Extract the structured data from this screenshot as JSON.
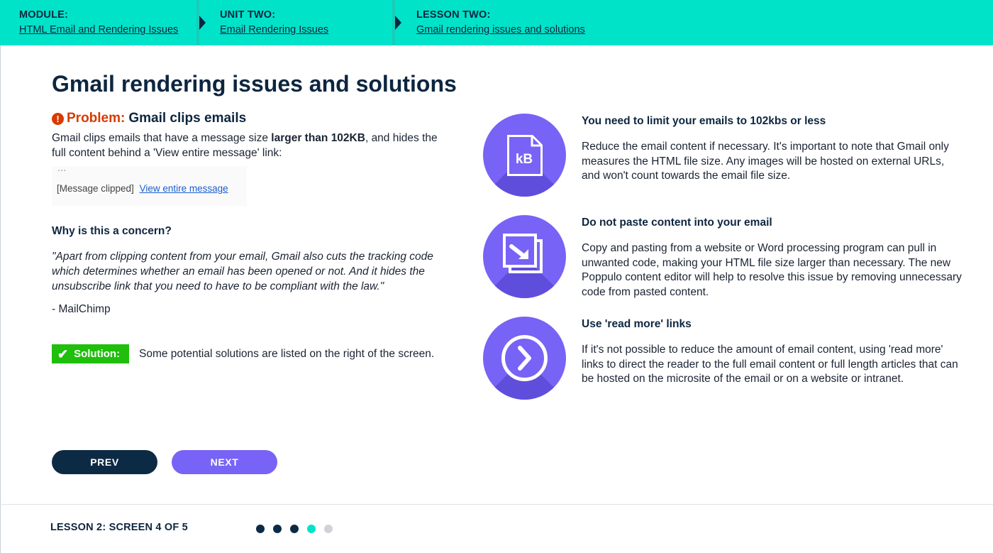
{
  "breadcrumbs": [
    {
      "label": "MODULE:",
      "link": "HTML Email and Rendering Issues"
    },
    {
      "label": "UNIT TWO:",
      "link": "Email Rendering Issues"
    },
    {
      "label": "LESSON TWO:",
      "link": "Gmail rendering issues and solutions"
    }
  ],
  "title": "Gmail rendering issues and solutions",
  "problem": {
    "icon": "exclamation-circle-icon",
    "label": "Problem:",
    "heading": "Gmail clips emails",
    "text_before": "Gmail clips emails that have a message size ",
    "text_bold": "larger than 102KB",
    "text_after": ", and hides the full content behind a 'View entire message' link:"
  },
  "clip_example": {
    "dots": "...",
    "clipped_text": "[Message clipped]",
    "link_text": "View entire message"
  },
  "concern": {
    "heading": "Why is this a concern?",
    "quote": "\"Apart from clipping content from your email, Gmail also cuts the tracking code which determines whether an email has been opened or not. And it hides the unsubscribe link that you need to have to be compliant with the law.\"",
    "attribution": "- MailChimp"
  },
  "solution": {
    "icon": "checkmark-icon",
    "label": "Solution:",
    "text": "Some potential solutions are listed on the right of the screen."
  },
  "features": [
    {
      "icon": "file-kb-icon",
      "icon_text": "kB",
      "heading": "You need to limit your emails to 102kbs or less",
      "text": "Reduce the email content if necessary. It's important to note that Gmail only measures the HTML file size. Any images will be hosted on external URLs, and won't count towards the email file size."
    },
    {
      "icon": "paste-arrow-icon",
      "heading": "Do not paste content into your email",
      "text": "Copy and pasting from a website or Word processing program can pull in unwanted code, making your HTML file size larger than necessary. The new Poppulo content editor will help to resolve this issue by removing unnecessary code from pasted content."
    },
    {
      "icon": "chevron-right-circle-icon",
      "heading": "Use 'read more' links",
      "text": "If it's not possible to reduce the amount of email content, using 'read more' links to direct the reader to the full email content or full length articles that can be hosted on the microsite of the email or on a website or intranet."
    }
  ],
  "nav": {
    "prev": "PREV",
    "next": "NEXT"
  },
  "footer": {
    "screen_label": "LESSON 2: SCREEN 4 OF 5",
    "progress": {
      "current": 4,
      "total": 5
    }
  },
  "colors": {
    "accent_teal": "#00e3c8",
    "navy": "#0d2640",
    "purple": "#7763f5",
    "problem_red": "#d83a00",
    "solution_green": "#1fbf0c",
    "dot_done": "#0d2a45",
    "dot_current": "#00e3c8",
    "dot_todo": "#cfd3d6"
  }
}
